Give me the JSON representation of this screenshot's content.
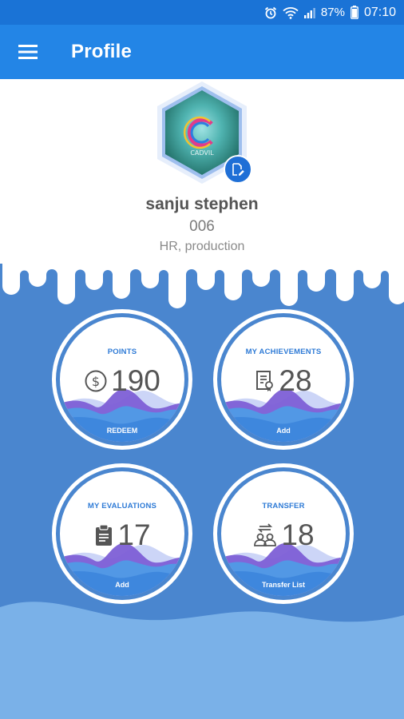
{
  "status_bar": {
    "battery_percent": "87%",
    "time": "07:10"
  },
  "app_bar": {
    "title": "Profile"
  },
  "profile": {
    "avatar_logo_text": "CADVIL",
    "name": "sanju stephen",
    "employee_id": "006",
    "department": "HR, production"
  },
  "cards": {
    "points": {
      "title": "POINTS",
      "value": "190",
      "caption": "REDEEM",
      "icon": "dollar-coin-icon"
    },
    "achievements": {
      "title": "MY ACHIEVEMENTS",
      "value": "28",
      "caption": "Add",
      "icon": "certificate-icon"
    },
    "evaluations": {
      "title": "MY EVALUATIONS",
      "value": "17",
      "caption": "Add",
      "icon": "clipboard-icon"
    },
    "transfer": {
      "title": "TRANSFER",
      "value": "18",
      "caption": "Transfer List",
      "icon": "people-transfer-icon"
    }
  },
  "colors": {
    "status_bar": "#1a73d6",
    "app_bar": "#2385e6",
    "panel_blue": "#4a86cf",
    "bottom_wave": "#7ab1e8",
    "card_title": "#2f7bd6",
    "value_text": "#555555"
  }
}
